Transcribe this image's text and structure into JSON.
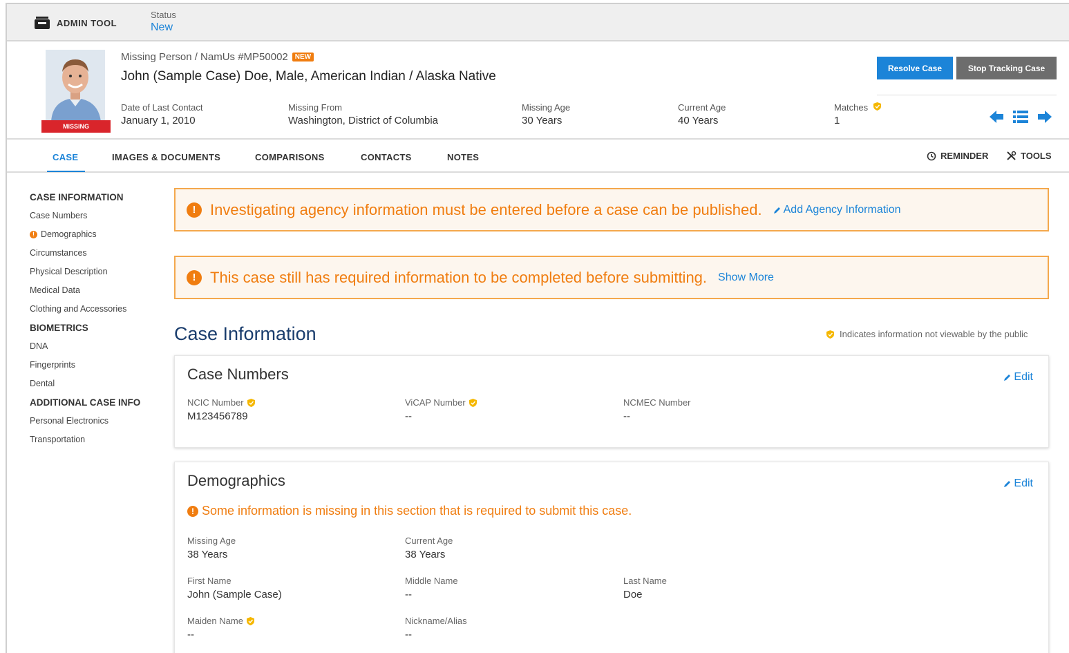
{
  "admin": {
    "tool_label": "ADMIN TOOL",
    "status_label": "Status",
    "status_value": "New"
  },
  "case": {
    "subtitle": "Missing Person / NamUs #MP50002",
    "new_badge": "NEW",
    "title": "John (Sample Case) Doe, Male, American Indian / Alaska Native",
    "missing_tag": "MISSING",
    "resolve_label": "Resolve Case",
    "stop_label": "Stop Tracking Case",
    "meta": [
      {
        "label": "Date of Last Contact",
        "value": "January 1, 2010"
      },
      {
        "label": "Missing From",
        "value": "Washington, District of Columbia"
      },
      {
        "label": "Missing Age",
        "value": "30 Years"
      },
      {
        "label": "Current Age",
        "value": "40 Years"
      },
      {
        "label": "Matches",
        "value": "1"
      }
    ]
  },
  "tabs": {
    "items": [
      {
        "label": "CASE"
      },
      {
        "label": "IMAGES & DOCUMENTS"
      },
      {
        "label": "COMPARISONS"
      },
      {
        "label": "CONTACTS"
      },
      {
        "label": "NOTES"
      }
    ],
    "reminder": "REMINDER",
    "tools": "TOOLS"
  },
  "sidebar": {
    "sections": [
      {
        "heading": "CASE INFORMATION",
        "items": [
          "Case Numbers",
          "Demographics",
          "Circumstances",
          "Physical Description",
          "Medical Data",
          "Clothing and Accessories"
        ]
      },
      {
        "heading": "BIOMETRICS",
        "items": [
          "DNA",
          "Fingerprints",
          "Dental"
        ]
      },
      {
        "heading": "ADDITIONAL CASE INFO",
        "items": [
          "Personal Electronics",
          "Transportation"
        ]
      }
    ]
  },
  "alerts": [
    {
      "text": "Investigating agency information must be entered before a case can be published.",
      "link": "Add Agency Information"
    },
    {
      "text": "This case still has required information to be completed before submitting.",
      "link": "Show More"
    }
  ],
  "main": {
    "section_title": "Case Information",
    "legend_note": "Indicates information not viewable by the public",
    "edit_label": "Edit"
  },
  "case_numbers": {
    "title": "Case Numbers",
    "fields": [
      {
        "label": "NCIC Number",
        "value": "M123456789"
      },
      {
        "label": "ViCAP Number",
        "value": "--"
      },
      {
        "label": "NCMEC Number",
        "value": "--"
      }
    ]
  },
  "demographics": {
    "title": "Demographics",
    "warning": "Some information is missing in this section that is required to submit this case.",
    "fields": [
      {
        "label": "Missing Age",
        "value": "38 Years"
      },
      {
        "label": "Current Age",
        "value": "38 Years"
      },
      {
        "label": "First Name",
        "value": "John (Sample Case)"
      },
      {
        "label": "Middle Name",
        "value": "--"
      },
      {
        "label": "Last Name",
        "value": "Doe"
      },
      {
        "label": "Maiden Name",
        "value": "--"
      },
      {
        "label": "Nickname/Alias",
        "value": "--"
      }
    ]
  },
  "colors": {
    "accent": "#1c84d8",
    "warning": "#f07d10",
    "missing": "#d9252b",
    "shield": "#f5b700"
  }
}
